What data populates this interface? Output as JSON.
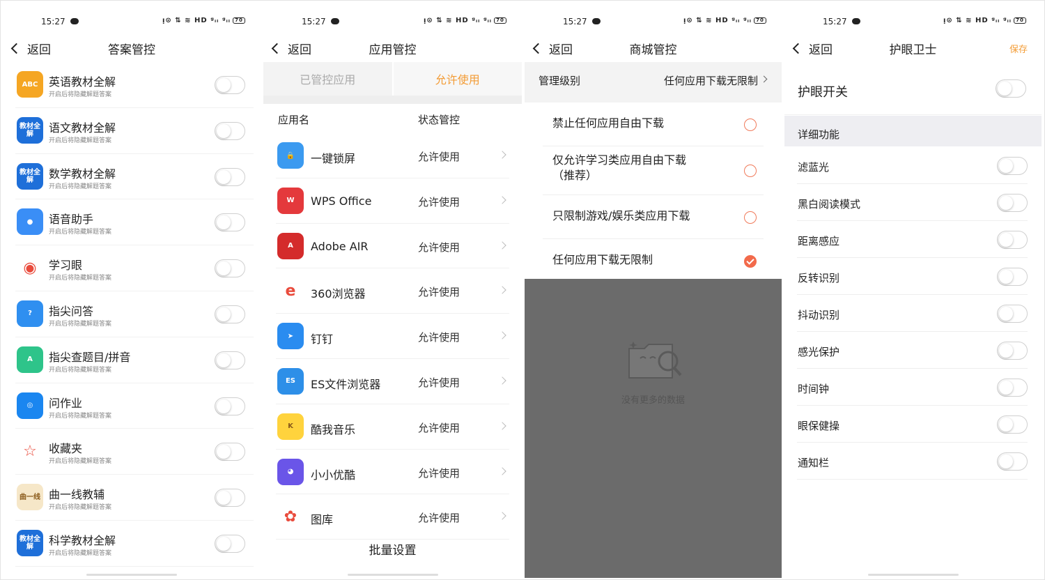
{
  "status": {
    "time": "15:27",
    "icons": "ᴉ⊙ ⇅ ≋ HD ᵍᵢₗ ᵍᵢₗ",
    "battery": "70"
  },
  "panel1": {
    "back": "返回",
    "title": "答案管控",
    "items": [
      {
        "name": "英语教材全解",
        "sub": "开启后将隐藏解题答案",
        "icon": "abc-book-icon",
        "label": "ABC",
        "color": "#f5a623"
      },
      {
        "name": "语文教材全解",
        "sub": "开启后将隐藏解题答案",
        "icon": "textbook-icon",
        "label": "教材全解",
        "color": "#1e6fd9"
      },
      {
        "name": "数学教材全解",
        "sub": "开启后将隐藏解题答案",
        "icon": "textbook-icon",
        "label": "教材全解",
        "color": "#1e6fd9"
      },
      {
        "name": "语音助手",
        "sub": "开启后将隐藏解题答案",
        "icon": "microphone-icon",
        "label": "●",
        "color": "#3a8ef6"
      },
      {
        "name": "学习眼",
        "sub": "开启后将隐藏解题答案",
        "icon": "eye-icon",
        "label": "◉",
        "color": "#ffffff"
      },
      {
        "name": "指尖问答",
        "sub": "开启后将隐藏解题答案",
        "icon": "finger-qa-icon",
        "label": "?",
        "color": "#2f8ff0"
      },
      {
        "name": "指尖查题目/拼音",
        "sub": "开启后将隐藏解题答案",
        "icon": "pinyin-icon",
        "label": "A",
        "color": "#2ec48a"
      },
      {
        "name": "问作业",
        "sub": "开启后将隐藏解题答案",
        "icon": "camera-icon",
        "label": "◎",
        "color": "#1a86f0"
      },
      {
        "name": "收藏夹",
        "sub": "开启后将隐藏解题答案",
        "icon": "star-icon",
        "label": "☆",
        "color": "#ffffff"
      },
      {
        "name": "曲一线教辅",
        "sub": "开启后将隐藏解题答案",
        "icon": "qu-yixian-icon",
        "label": "曲一线",
        "color": "#f6e7c8"
      },
      {
        "name": "科学教材全解",
        "sub": "开启后将隐藏解题答案",
        "icon": "textbook-icon",
        "label": "教材全解",
        "color": "#1e6fd9"
      }
    ]
  },
  "panel2": {
    "back": "返回",
    "title": "应用管控",
    "tabs": [
      "已管控应用",
      "允许使用"
    ],
    "col_name": "应用名",
    "col_status": "状态管控",
    "items": [
      {
        "name": "一键锁屏",
        "status": "允许使用",
        "icon": "lock-icon",
        "label": "🔒",
        "color": "#3b9af0"
      },
      {
        "name": "WPS Office",
        "status": "允许使用",
        "icon": "wps-icon",
        "label": "W",
        "color": "#e4393c"
      },
      {
        "name": "Adobe AIR",
        "status": "允许使用",
        "icon": "adobe-air-icon",
        "label": "A",
        "color": "#d42b2b"
      },
      {
        "name": "360浏览器",
        "status": "允许使用",
        "icon": "browser-360-icon",
        "label": "e",
        "color": "#ffffff"
      },
      {
        "name": "钉钉",
        "status": "允许使用",
        "icon": "dingtalk-icon",
        "label": "➤",
        "color": "#2a8cf0"
      },
      {
        "name": "ES文件浏览器",
        "status": "允许使用",
        "icon": "es-file-icon",
        "label": "ES",
        "color": "#2d8fe8"
      },
      {
        "name": "酷我音乐",
        "status": "允许使用",
        "icon": "kuwo-icon",
        "label": "K",
        "color": "#ffd33d"
      },
      {
        "name": "小小优酷",
        "status": "允许使用",
        "icon": "youku-kids-icon",
        "label": "◕",
        "color": "#6a55e8"
      },
      {
        "name": "图库",
        "status": "允许使用",
        "icon": "gallery-icon",
        "label": "✿",
        "color": "#ffffff"
      }
    ],
    "batch": "批量设置"
  },
  "panel3": {
    "back": "返回",
    "title": "商城管控",
    "level_label": "管理级别",
    "level_value": "任何应用下载无限制",
    "options": [
      {
        "lines": [
          "禁止任何应用自由下载"
        ],
        "checked": false
      },
      {
        "lines": [
          "仅允许学习类应用自由下载",
          "（推荐）"
        ],
        "checked": false
      },
      {
        "lines": [
          "只限制游戏/娱乐类应用下载"
        ],
        "checked": false
      },
      {
        "lines": [
          "任何应用下载无限制"
        ],
        "checked": true
      }
    ],
    "empty_text": "没有更多的数据"
  },
  "panel4": {
    "back": "返回",
    "title": "护眼卫士",
    "save": "保存",
    "main_switch": "护眼开关",
    "section": "详细功能",
    "items": [
      "滤蓝光",
      "黑白阅读模式",
      "距离感应",
      "反转识别",
      "抖动识别",
      "感光保护",
      "时间钟",
      "眼保健操",
      "通知栏"
    ]
  },
  "colors": {
    "accent": "#f39c36",
    "radio": "#f26a4b",
    "overlay": "#6b6b6b"
  }
}
